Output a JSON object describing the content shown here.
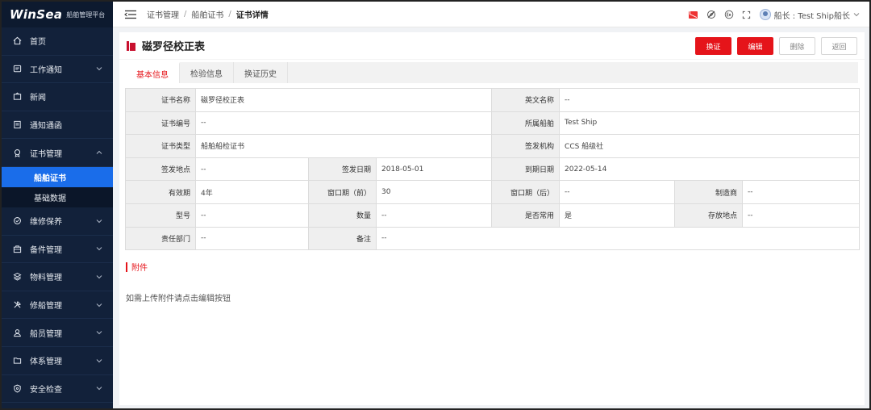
{
  "brand": {
    "logo": "WinSea",
    "subtitle": "船舶管理平台"
  },
  "sidebar": {
    "items": [
      {
        "label": "首页",
        "icon": "home-icon",
        "expandable": false
      },
      {
        "label": "工作通知",
        "icon": "message-icon",
        "expandable": true
      },
      {
        "label": "新闻",
        "icon": "news-icon",
        "expandable": false
      },
      {
        "label": "通知通函",
        "icon": "notice-icon",
        "expandable": false
      },
      {
        "label": "证书管理",
        "icon": "certificate-icon",
        "expandable": true,
        "expanded": true
      },
      {
        "label": "维修保养",
        "icon": "maintenance-icon",
        "expandable": true
      },
      {
        "label": "备件管理",
        "icon": "spare-parts-icon",
        "expandable": true
      },
      {
        "label": "物料管理",
        "icon": "materials-icon",
        "expandable": true
      },
      {
        "label": "修船管理",
        "icon": "repair-icon",
        "expandable": true
      },
      {
        "label": "船员管理",
        "icon": "crew-icon",
        "expandable": true
      },
      {
        "label": "体系管理",
        "icon": "folder-icon",
        "expandable": true
      },
      {
        "label": "安全检查",
        "icon": "shield-icon",
        "expandable": true
      }
    ],
    "subitems": [
      {
        "label": "船舶证书",
        "active": true
      },
      {
        "label": "基础数据",
        "active": false
      }
    ]
  },
  "header": {
    "breadcrumb": [
      "证书管理",
      "船舶证书",
      "证书详情"
    ],
    "separator": "/",
    "user": "船长 : Test Ship船长"
  },
  "page": {
    "title": "磁罗径校正表",
    "buttons": {
      "change": "换证",
      "edit": "编辑",
      "delete": "删除",
      "back": "返回"
    },
    "tabs": [
      {
        "label": "基本信息",
        "active": true
      },
      {
        "label": "检验信息",
        "active": false
      },
      {
        "label": "换证历史",
        "active": false
      }
    ]
  },
  "info": {
    "cert_name_label": "证书名称",
    "cert_name": "磁罗径校正表",
    "en_name_label": "英文名称",
    "en_name": "--",
    "cert_no_label": "证书编号",
    "cert_no": "--",
    "ship_label": "所属船舶",
    "ship": "Test Ship",
    "cert_type_label": "证书类型",
    "cert_type": "船舶船检证书",
    "issuer_label": "签发机构",
    "issuer": "CCS 船级社",
    "issue_place_label": "签发地点",
    "issue_place": "--",
    "issue_date_label": "签发日期",
    "issue_date": "2018-05-01",
    "expiry_label": "到期日期",
    "expiry": "2022-05-14",
    "validity_label": "有效期",
    "validity": "4年",
    "window_before_label": "窗口期（前）",
    "window_before": "30",
    "window_after_label": "窗口期（后）",
    "window_after": "--",
    "maker_label": "制造商",
    "maker": "--",
    "model_label": "型号",
    "model": "--",
    "qty_label": "数量",
    "qty": "--",
    "common_label": "是否常用",
    "common": "是",
    "location_label": "存放地点",
    "location": "--",
    "dept_label": "责任部门",
    "dept": "--",
    "remark_label": "备注",
    "remark": "--"
  },
  "attachments": {
    "title": "附件",
    "hint": "如需上传附件请点击编辑按钮"
  },
  "colors": {
    "accent": "#e5141a",
    "sidebar_bg": "#12213a",
    "active_blue": "#1a6dea"
  }
}
